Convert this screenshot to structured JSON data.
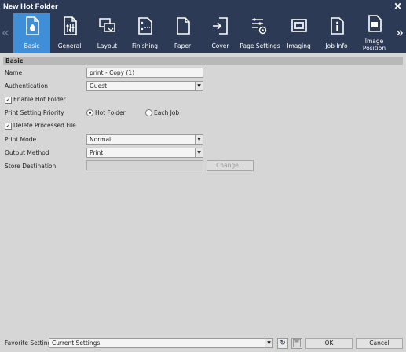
{
  "window": {
    "title": "New Hot Folder",
    "close_glyph": "✕"
  },
  "toolbar": {
    "prev_glyph": "«",
    "next_glyph": "»",
    "tabs": [
      {
        "label": "Basic",
        "icon": "basic-icon"
      },
      {
        "label": "General",
        "icon": "general-icon"
      },
      {
        "label": "Layout",
        "icon": "layout-icon"
      },
      {
        "label": "Finishing",
        "icon": "finishing-icon"
      },
      {
        "label": "Paper",
        "icon": "paper-icon"
      },
      {
        "label": "Cover",
        "icon": "cover-icon"
      },
      {
        "label": "Page Settings",
        "icon": "page-settings-icon"
      },
      {
        "label": "Imaging",
        "icon": "imaging-icon"
      },
      {
        "label": "Job Info",
        "icon": "job-info-icon"
      },
      {
        "label": "Image Position",
        "icon": "image-position-icon"
      }
    ],
    "active_tab": "Basic"
  },
  "basic": {
    "section_title": "Basic",
    "name_label": "Name",
    "name_value": "print - Copy (1)",
    "auth_label": "Authentication",
    "auth_value": "Guest",
    "enable_hot_folder_label": "Enable Hot Folder",
    "enable_hot_folder_checked": true,
    "priority_label": "Print Setting Priority",
    "priority_options": [
      "Hot Folder",
      "Each Job"
    ],
    "priority_selected": "Hot Folder",
    "delete_processed_label": "Delete Processed File",
    "delete_processed_checked": true,
    "print_mode_label": "Print Mode",
    "print_mode_value": "Normal",
    "output_method_label": "Output Method",
    "output_method_value": "Print",
    "store_dest_label": "Store Destination",
    "store_dest_value": "",
    "change_button": "Change..."
  },
  "footer": {
    "favorite_label": "Favorite Setting",
    "favorite_value": "Current Settings",
    "ok_label": "OK",
    "cancel_label": "Cancel"
  },
  "colors": {
    "title_bg": "#2d3a55",
    "active_tab": "#3f8ed8",
    "panel_bg": "#d6d6d6"
  }
}
